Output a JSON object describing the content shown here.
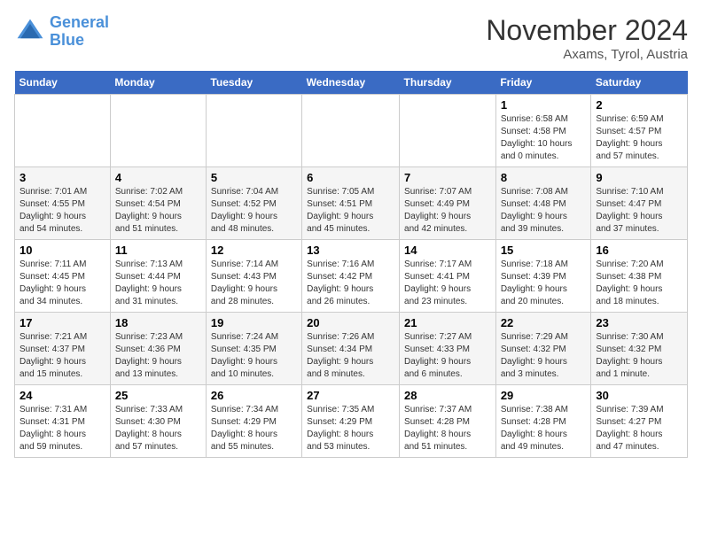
{
  "header": {
    "logo_line1": "General",
    "logo_line2": "Blue",
    "month": "November 2024",
    "location": "Axams, Tyrol, Austria"
  },
  "weekdays": [
    "Sunday",
    "Monday",
    "Tuesday",
    "Wednesday",
    "Thursday",
    "Friday",
    "Saturday"
  ],
  "weeks": [
    [
      {
        "day": "",
        "info": ""
      },
      {
        "day": "",
        "info": ""
      },
      {
        "day": "",
        "info": ""
      },
      {
        "day": "",
        "info": ""
      },
      {
        "day": "",
        "info": ""
      },
      {
        "day": "1",
        "info": "Sunrise: 6:58 AM\nSunset: 4:58 PM\nDaylight: 10 hours\nand 0 minutes."
      },
      {
        "day": "2",
        "info": "Sunrise: 6:59 AM\nSunset: 4:57 PM\nDaylight: 9 hours\nand 57 minutes."
      }
    ],
    [
      {
        "day": "3",
        "info": "Sunrise: 7:01 AM\nSunset: 4:55 PM\nDaylight: 9 hours\nand 54 minutes."
      },
      {
        "day": "4",
        "info": "Sunrise: 7:02 AM\nSunset: 4:54 PM\nDaylight: 9 hours\nand 51 minutes."
      },
      {
        "day": "5",
        "info": "Sunrise: 7:04 AM\nSunset: 4:52 PM\nDaylight: 9 hours\nand 48 minutes."
      },
      {
        "day": "6",
        "info": "Sunrise: 7:05 AM\nSunset: 4:51 PM\nDaylight: 9 hours\nand 45 minutes."
      },
      {
        "day": "7",
        "info": "Sunrise: 7:07 AM\nSunset: 4:49 PM\nDaylight: 9 hours\nand 42 minutes."
      },
      {
        "day": "8",
        "info": "Sunrise: 7:08 AM\nSunset: 4:48 PM\nDaylight: 9 hours\nand 39 minutes."
      },
      {
        "day": "9",
        "info": "Sunrise: 7:10 AM\nSunset: 4:47 PM\nDaylight: 9 hours\nand 37 minutes."
      }
    ],
    [
      {
        "day": "10",
        "info": "Sunrise: 7:11 AM\nSunset: 4:45 PM\nDaylight: 9 hours\nand 34 minutes."
      },
      {
        "day": "11",
        "info": "Sunrise: 7:13 AM\nSunset: 4:44 PM\nDaylight: 9 hours\nand 31 minutes."
      },
      {
        "day": "12",
        "info": "Sunrise: 7:14 AM\nSunset: 4:43 PM\nDaylight: 9 hours\nand 28 minutes."
      },
      {
        "day": "13",
        "info": "Sunrise: 7:16 AM\nSunset: 4:42 PM\nDaylight: 9 hours\nand 26 minutes."
      },
      {
        "day": "14",
        "info": "Sunrise: 7:17 AM\nSunset: 4:41 PM\nDaylight: 9 hours\nand 23 minutes."
      },
      {
        "day": "15",
        "info": "Sunrise: 7:18 AM\nSunset: 4:39 PM\nDaylight: 9 hours\nand 20 minutes."
      },
      {
        "day": "16",
        "info": "Sunrise: 7:20 AM\nSunset: 4:38 PM\nDaylight: 9 hours\nand 18 minutes."
      }
    ],
    [
      {
        "day": "17",
        "info": "Sunrise: 7:21 AM\nSunset: 4:37 PM\nDaylight: 9 hours\nand 15 minutes."
      },
      {
        "day": "18",
        "info": "Sunrise: 7:23 AM\nSunset: 4:36 PM\nDaylight: 9 hours\nand 13 minutes."
      },
      {
        "day": "19",
        "info": "Sunrise: 7:24 AM\nSunset: 4:35 PM\nDaylight: 9 hours\nand 10 minutes."
      },
      {
        "day": "20",
        "info": "Sunrise: 7:26 AM\nSunset: 4:34 PM\nDaylight: 9 hours\nand 8 minutes."
      },
      {
        "day": "21",
        "info": "Sunrise: 7:27 AM\nSunset: 4:33 PM\nDaylight: 9 hours\nand 6 minutes."
      },
      {
        "day": "22",
        "info": "Sunrise: 7:29 AM\nSunset: 4:32 PM\nDaylight: 9 hours\nand 3 minutes."
      },
      {
        "day": "23",
        "info": "Sunrise: 7:30 AM\nSunset: 4:32 PM\nDaylight: 9 hours\nand 1 minute."
      }
    ],
    [
      {
        "day": "24",
        "info": "Sunrise: 7:31 AM\nSunset: 4:31 PM\nDaylight: 8 hours\nand 59 minutes."
      },
      {
        "day": "25",
        "info": "Sunrise: 7:33 AM\nSunset: 4:30 PM\nDaylight: 8 hours\nand 57 minutes."
      },
      {
        "day": "26",
        "info": "Sunrise: 7:34 AM\nSunset: 4:29 PM\nDaylight: 8 hours\nand 55 minutes."
      },
      {
        "day": "27",
        "info": "Sunrise: 7:35 AM\nSunset: 4:29 PM\nDaylight: 8 hours\nand 53 minutes."
      },
      {
        "day": "28",
        "info": "Sunrise: 7:37 AM\nSunset: 4:28 PM\nDaylight: 8 hours\nand 51 minutes."
      },
      {
        "day": "29",
        "info": "Sunrise: 7:38 AM\nSunset: 4:28 PM\nDaylight: 8 hours\nand 49 minutes."
      },
      {
        "day": "30",
        "info": "Sunrise: 7:39 AM\nSunset: 4:27 PM\nDaylight: 8 hours\nand 47 minutes."
      }
    ]
  ]
}
